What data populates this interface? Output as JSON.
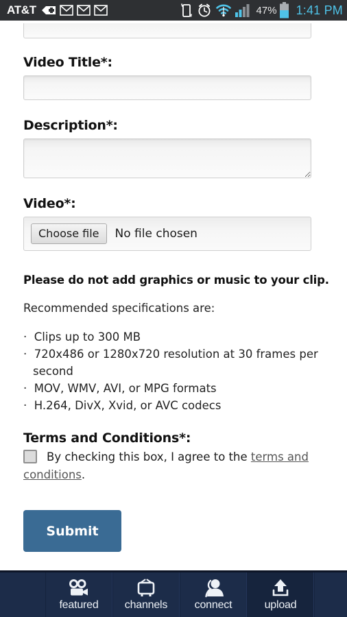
{
  "status_bar": {
    "carrier": "AT&T",
    "battery_percent": "47%",
    "time": "1:41 PM",
    "icons": [
      "plus-badge-icon",
      "gmail-icon",
      "gmail-icon",
      "gmail-icon",
      "vibrate-phone-icon",
      "alarm-clock-icon",
      "wifi-icon",
      "cell-signal-icon",
      "battery-icon"
    ],
    "accent_color": "#4fc3e8",
    "background_color": "#2e3033"
  },
  "form": {
    "video_title": {
      "label": "Video Title*:",
      "value": "",
      "placeholder": ""
    },
    "description": {
      "label": "Description*:",
      "value": "",
      "placeholder": ""
    },
    "video_file": {
      "label": "Video*:",
      "button_label": "Choose file",
      "status_text": "No file chosen"
    }
  },
  "guidelines": {
    "warning": "Please do not add graphics or music to your clip.",
    "intro": "Recommended specifications are:",
    "items": [
      "Clips up to 300 MB",
      "720x486 or 1280x720 resolution at 30 frames per second",
      "MOV, WMV, AVI, or MPG formats",
      "H.264, DivX, Xvid, or AVC codecs"
    ]
  },
  "terms": {
    "heading": "Terms and Conditions*:",
    "checkbox_checked": false,
    "text_before": "By checking this box, I agree to the ",
    "link_text": "terms and conditions",
    "text_after": "."
  },
  "submit": {
    "label": "Submit",
    "color": "#3a6b94"
  },
  "bottom_nav": {
    "background_color": "#1c2c49",
    "items": [
      {
        "label": "featured",
        "icon": "video-camera-icon",
        "active": false
      },
      {
        "label": "channels",
        "icon": "television-icon",
        "active": false
      },
      {
        "label": "connect",
        "icon": "person-icon",
        "active": false
      },
      {
        "label": "upload",
        "icon": "upload-arrow-icon",
        "active": true
      }
    ]
  }
}
